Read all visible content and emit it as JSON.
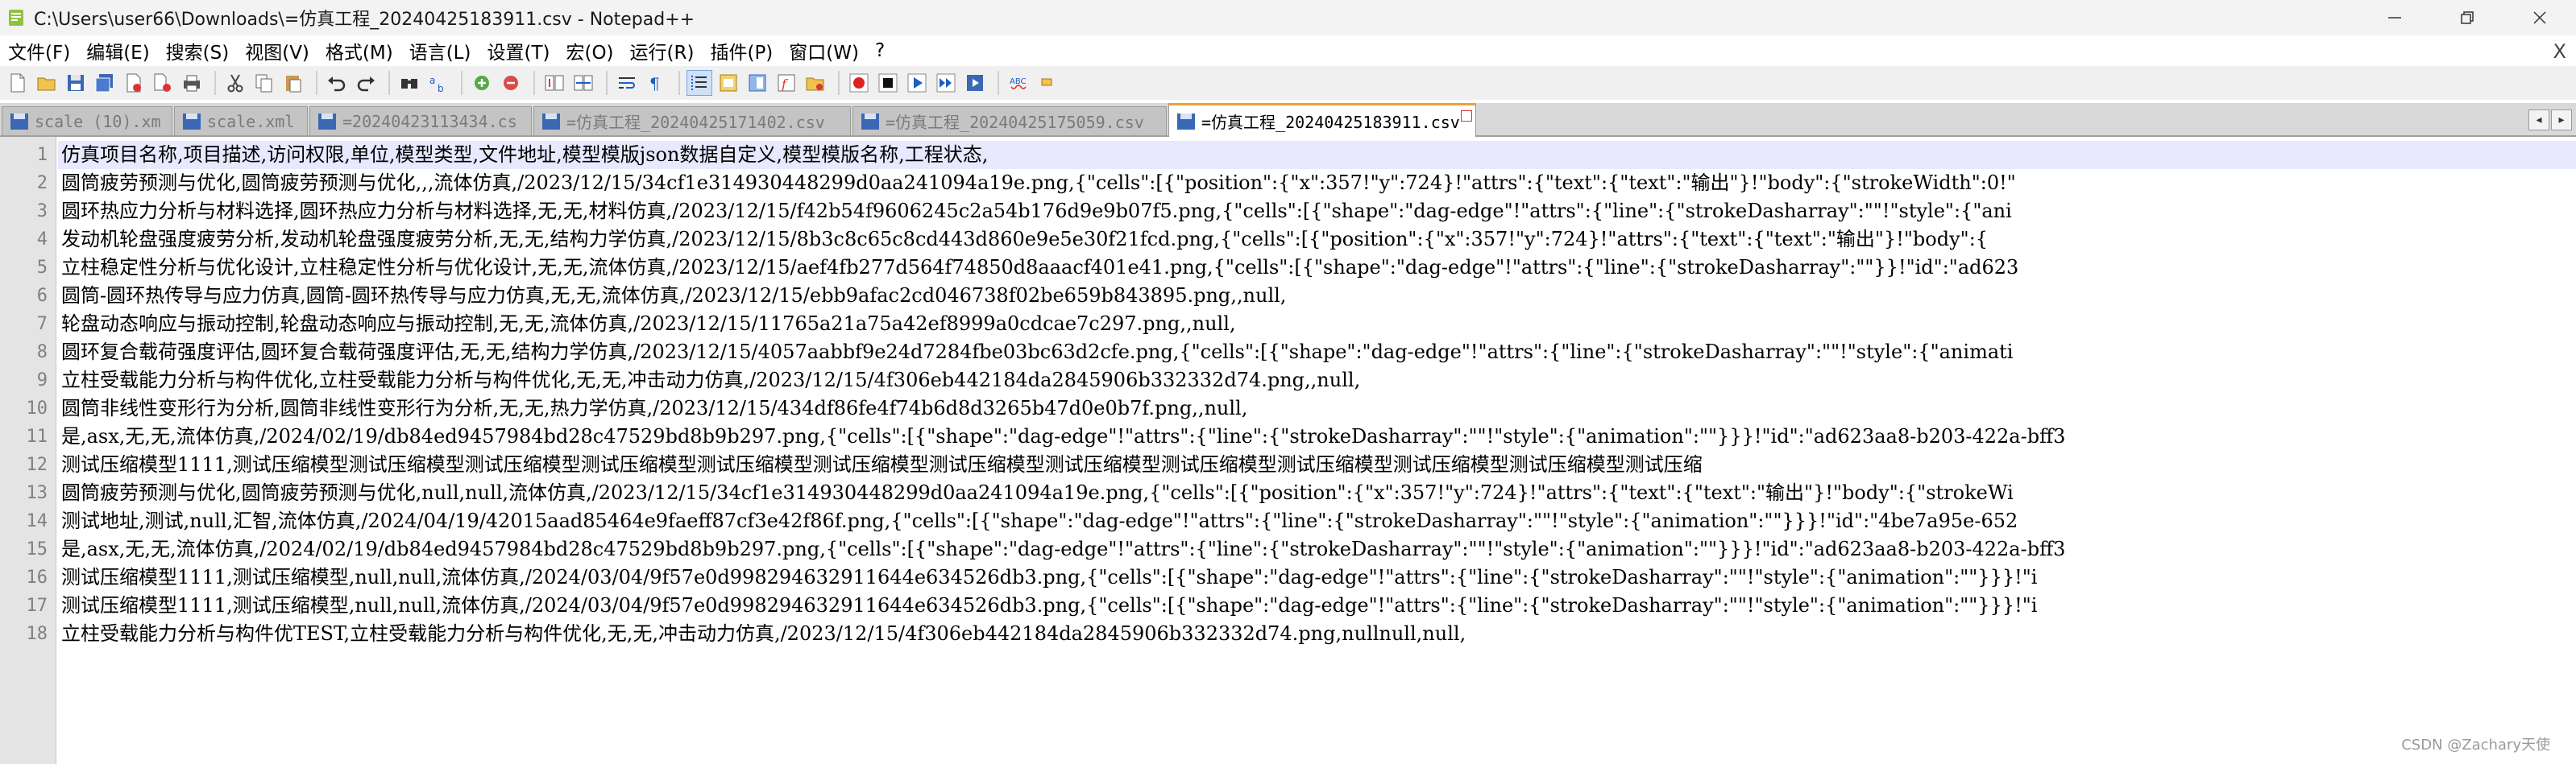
{
  "window": {
    "title": "C:\\Users\\user66\\Downloads\\=仿真工程_20240425183911.csv - Notepad++"
  },
  "menu": [
    "文件(F)",
    "编辑(E)",
    "搜索(S)",
    "视图(V)",
    "格式(M)",
    "语言(L)",
    "设置(T)",
    "宏(O)",
    "运行(R)",
    "插件(P)",
    "窗口(W)",
    "?"
  ],
  "menu_close": "X",
  "toolbar_icons": [
    "new-file-icon",
    "open-file-icon",
    "save-icon",
    "save-all-icon",
    "close-icon",
    "close-all-icon",
    "print-icon",
    "cut-icon",
    "copy-icon",
    "paste-icon",
    "undo-icon",
    "redo-icon",
    "find-icon",
    "replace-icon",
    "zoom-in-icon",
    "zoom-out-icon",
    "sync-vertical-icon",
    "sync-horizontal-icon",
    "word-wrap-icon",
    "show-all-chars-icon",
    "indent-guide-icon",
    "udl-icon",
    "doc-map-icon",
    "function-list-icon",
    "folder-workspace-icon",
    "record-macro-icon",
    "stop-record-icon",
    "play-macro-icon",
    "run-multiple-icon",
    "save-macro-icon",
    "spellcheck-icon",
    "misc-icon"
  ],
  "tabs": [
    {
      "label": "scale (10).xm",
      "active": false
    },
    {
      "label": "scale.xml",
      "active": false
    },
    {
      "label": "=20240423113434.cs",
      "active": false
    },
    {
      "label": "=仿真工程_20240425171402.csv",
      "active": false
    },
    {
      "label": "=仿真工程_20240425175059.csv",
      "active": false
    },
    {
      "label": "=仿真工程_20240425183911.csv",
      "active": true
    }
  ],
  "tab_scroll": {
    "left": "◂",
    "right": "▸"
  },
  "lines": [
    "仿真项目名称,项目描述,访问权限,单位,模型类型,文件地址,模型模版json数据自定义,模型模版名称,工程状态,",
    "圆筒疲劳预测与优化,圆筒疲劳预测与优化,,,流体仿真,/2023/12/15/34cf1e314930448299d0aa241094a19e.png,{\"cells\":[{\"position\":{\"x\":357!\"y\":724}!\"attrs\":{\"text\":{\"text\":\"输出\"}!\"body\":{\"strokeWidth\":0!\"",
    "圆环热应力分析与材料选择,圆环热应力分析与材料选择,无,无,材料仿真,/2023/12/15/f42b54f9606245c2a54b176d9e9b07f5.png,{\"cells\":[{\"shape\":\"dag-edge\"!\"attrs\":{\"line\":{\"strokeDasharray\":\"\"!\"style\":{\"ani",
    "发动机轮盘强度疲劳分析,发动机轮盘强度疲劳分析,无,无,结构力学仿真,/2023/12/15/8b3c8c65c8cd443d860e9e5e30f21fcd.png,{\"cells\":[{\"position\":{\"x\":357!\"y\":724}!\"attrs\":{\"text\":{\"text\":\"输出\"}!\"body\":{",
    "立柱稳定性分析与优化设计,立柱稳定性分析与优化设计,无,无,流体仿真,/2023/12/15/aef4fb277d564f74850d8aaacf401e41.png,{\"cells\":[{\"shape\":\"dag-edge\"!\"attrs\":{\"line\":{\"strokeDasharray\":\"\"}}!\"id\":\"ad623",
    "圆筒-圆环热传导与应力仿真,圆筒-圆环热传导与应力仿真,无,无,流体仿真,/2023/12/15/ebb9afac2cd046738f02be659b843895.png,,null,",
    "轮盘动态响应与振动控制,轮盘动态响应与振动控制,无,无,流体仿真,/2023/12/15/11765a21a75a42ef8999a0cdcae7c297.png,,null,",
    "圆环复合载荷强度评估,圆环复合载荷强度评估,无,无,结构力学仿真,/2023/12/15/4057aabbf9e24d7284fbe03bc63d2cfe.png,{\"cells\":[{\"shape\":\"dag-edge\"!\"attrs\":{\"line\":{\"strokeDasharray\":\"\"!\"style\":{\"animati",
    "立柱受载能力分析与构件优化,立柱受载能力分析与构件优化,无,无,冲击动力仿真,/2023/12/15/4f306eb442184da2845906b332332d74.png,,null,",
    "圆筒非线性变形行为分析,圆筒非线性变形行为分析,无,无,热力学仿真,/2023/12/15/434df86fe4f74b6d8d3265b47d0e0b7f.png,,null,",
    "是,asx,无,无,流体仿真,/2024/02/19/db84ed9457984bd28c47529bd8b9b297.png,{\"cells\":[{\"shape\":\"dag-edge\"!\"attrs\":{\"line\":{\"strokeDasharray\":\"\"!\"style\":{\"animation\":\"\"}}}!\"id\":\"ad623aa8-b203-422a-bff3",
    "测试压缩模型1111,测试压缩模型测试压缩模型测试压缩模型测试压缩模型测试压缩模型测试压缩模型测试压缩模型测试压缩模型测试压缩模型测试压缩模型测试压缩模型测试压缩模型测试压缩",
    "圆筒疲劳预测与优化,圆筒疲劳预测与优化,null,null,流体仿真,/2023/12/15/34cf1e314930448299d0aa241094a19e.png,{\"cells\":[{\"position\":{\"x\":357!\"y\":724}!\"attrs\":{\"text\":{\"text\":\"输出\"}!\"body\":{\"strokeWi",
    "测试地址,测试,null,汇智,流体仿真,/2024/04/19/42015aad85464e9faeff87cf3e42f86f.png,{\"cells\":[{\"shape\":\"dag-edge\"!\"attrs\":{\"line\":{\"strokeDasharray\":\"\"!\"style\":{\"animation\":\"\"}}}!\"id\":\"4be7a95e-652",
    "是,asx,无,无,流体仿真,/2024/02/19/db84ed9457984bd28c47529bd8b9b297.png,{\"cells\":[{\"shape\":\"dag-edge\"!\"attrs\":{\"line\":{\"strokeDasharray\":\"\"!\"style\":{\"animation\":\"\"}}}!\"id\":\"ad623aa8-b203-422a-bff3",
    "测试压缩模型1111,测试压缩模型,null,null,流体仿真,/2024/03/04/9f57e0d998294632911644e634526db3.png,{\"cells\":[{\"shape\":\"dag-edge\"!\"attrs\":{\"line\":{\"strokeDasharray\":\"\"!\"style\":{\"animation\":\"\"}}}!\"i",
    "测试压缩模型1111,测试压缩模型,null,null,流体仿真,/2024/03/04/9f57e0d998294632911644e634526db3.png,{\"cells\":[{\"shape\":\"dag-edge\"!\"attrs\":{\"line\":{\"strokeDasharray\":\"\"!\"style\":{\"animation\":\"\"}}}!\"i",
    "立柱受载能力分析与构件优TEST,立柱受载能力分析与构件优化,无,无,冲击动力仿真,/2023/12/15/4f306eb442184da2845906b332332d74.png,nullnull,null,"
  ],
  "line_numbers": [
    "1",
    "2",
    "3",
    "4",
    "5",
    "6",
    "7",
    "8",
    "9",
    "10",
    "11",
    "12",
    "13",
    "14",
    "15",
    "16",
    "17",
    "18"
  ],
  "watermark": "CSDN @Zachary天使",
  "colors": {
    "active_tab_accent": "#f0a030",
    "current_line": "#e8e8ff",
    "gutter": "#e4e4e4"
  }
}
